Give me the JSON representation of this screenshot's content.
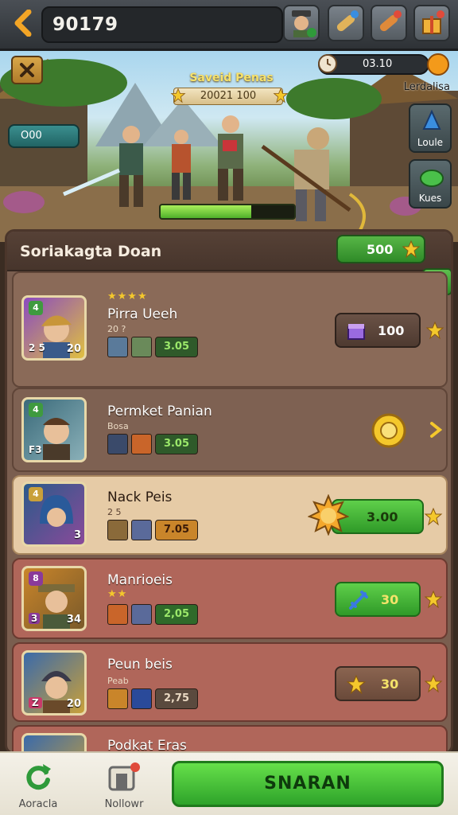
{
  "topbar": {
    "currency_value": "90179",
    "icons": [
      "back-icon",
      "avatar-icon",
      "scroll-icon",
      "scroll-icon",
      "gift-icon"
    ]
  },
  "scene": {
    "stage_title": "Saveid Penas",
    "stage_subtitle": "20021 100",
    "timer": "03.10",
    "side_label": "Lerdalisa",
    "side_buttons": [
      {
        "label": "Loule",
        "icon": "potion-icon"
      },
      {
        "label": "Kues",
        "icon": "slime-icon"
      }
    ],
    "left_pill": "O00",
    "hp_fraction": 0.68
  },
  "panel": {
    "title": "Soriakagta Doan",
    "coin_button_value": "500",
    "rows": [
      {
        "name": "Pirra Ueeh",
        "sub": "20 ?",
        "stars": "★★★★",
        "level": "4",
        "portrait_badge": "2 5",
        "portrait_num": "20",
        "power": "3.05",
        "action_value": "100",
        "action_icon": "chest-icon"
      },
      {
        "name": "Permket Panian",
        "sub": "Bosa",
        "stars": "",
        "level": "4",
        "portrait_badge": "F3",
        "portrait_num": "",
        "power": "3.05",
        "action_value": "",
        "action_icon": "sun-medal-icon"
      },
      {
        "name": "Nack Peis",
        "sub": "2 5",
        "stars": "",
        "level": "4",
        "portrait_badge": "",
        "portrait_num": "3",
        "power": "7.05",
        "action_value": "3.00",
        "action_icon": "sun-medal-icon"
      },
      {
        "name": "Manrioeis",
        "sub": "",
        "stars": "★★",
        "level": "8",
        "portrait_badge": "3",
        "portrait_num": "34",
        "power": "2,05",
        "action_value": "30",
        "action_icon": "sword-icon"
      },
      {
        "name": "Peun beis",
        "sub": "Peab",
        "stars": "",
        "level": "",
        "portrait_badge": "Z",
        "portrait_num": "20",
        "power": "2,75",
        "action_value": "30",
        "action_icon": "star-icon"
      },
      {
        "name": "Podkat Eras",
        "sub": "",
        "stars": "",
        "level": "",
        "portrait_badge": "",
        "portrait_num": "",
        "power": "",
        "action_value": "",
        "action_icon": "star-icon"
      }
    ]
  },
  "bottom_nav": {
    "left_label": "Aoracla",
    "middle_label": "Nollowr",
    "cta_label": "SNARAN"
  },
  "colors": {
    "accent_green": "#3aa42f",
    "gold": "#f4c82c",
    "panel_brown": "#7a5e4f"
  }
}
